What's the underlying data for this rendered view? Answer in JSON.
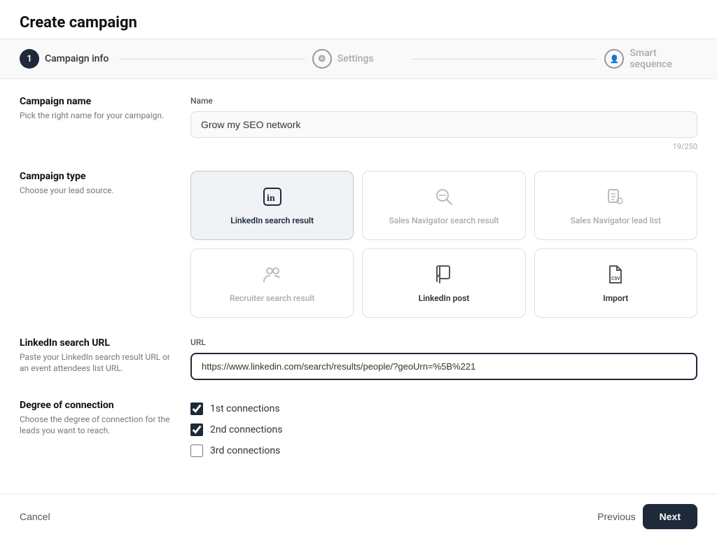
{
  "page": {
    "title": "Create campaign"
  },
  "stepper": {
    "steps": [
      {
        "id": "campaign-info",
        "label": "Campaign info",
        "icon": "1",
        "active": true
      },
      {
        "id": "settings",
        "label": "Settings",
        "icon": "⚙",
        "active": false
      },
      {
        "id": "smart-sequence",
        "label": "Smart sequence",
        "icon": "👤",
        "active": false
      }
    ]
  },
  "form": {
    "campaign_name_section": {
      "heading": "Campaign name",
      "description": "Pick the right name for your campaign.",
      "field_label": "Name",
      "value": "Grow my SEO network",
      "char_count": "19/250"
    },
    "campaign_type_section": {
      "heading": "Campaign type",
      "description": "Choose your lead source.",
      "types": [
        {
          "id": "linkedin-search",
          "label": "LinkedIn search result",
          "selected": true
        },
        {
          "id": "sales-nav-search",
          "label": "Sales Navigator search result",
          "selected": false
        },
        {
          "id": "sales-nav-lead",
          "label": "Sales Navigator lead list",
          "selected": false
        },
        {
          "id": "recruiter-search",
          "label": "Recruiter search result",
          "selected": false
        },
        {
          "id": "linkedin-post",
          "label": "LinkedIn post",
          "selected": false
        },
        {
          "id": "import",
          "label": "Import",
          "selected": false
        }
      ]
    },
    "linkedin_url_section": {
      "heading": "LinkedIn search URL",
      "description": "Paste your LinkedIn search result URL or an event attendees list URL.",
      "field_label": "URL",
      "value": "https://www.linkedin.com/search/results/people/?geoUrn=%5B%221"
    },
    "degree_section": {
      "heading": "Degree of connection",
      "description": "Choose the degree of connection for the leads you want to reach.",
      "connections": [
        {
          "id": "first",
          "label": "1st connections",
          "checked": true
        },
        {
          "id": "second",
          "label": "2nd connections",
          "checked": true
        },
        {
          "id": "third",
          "label": "3rd connections",
          "checked": false
        }
      ]
    }
  },
  "footer": {
    "cancel_label": "Cancel",
    "previous_label": "Previous",
    "next_label": "Next"
  }
}
